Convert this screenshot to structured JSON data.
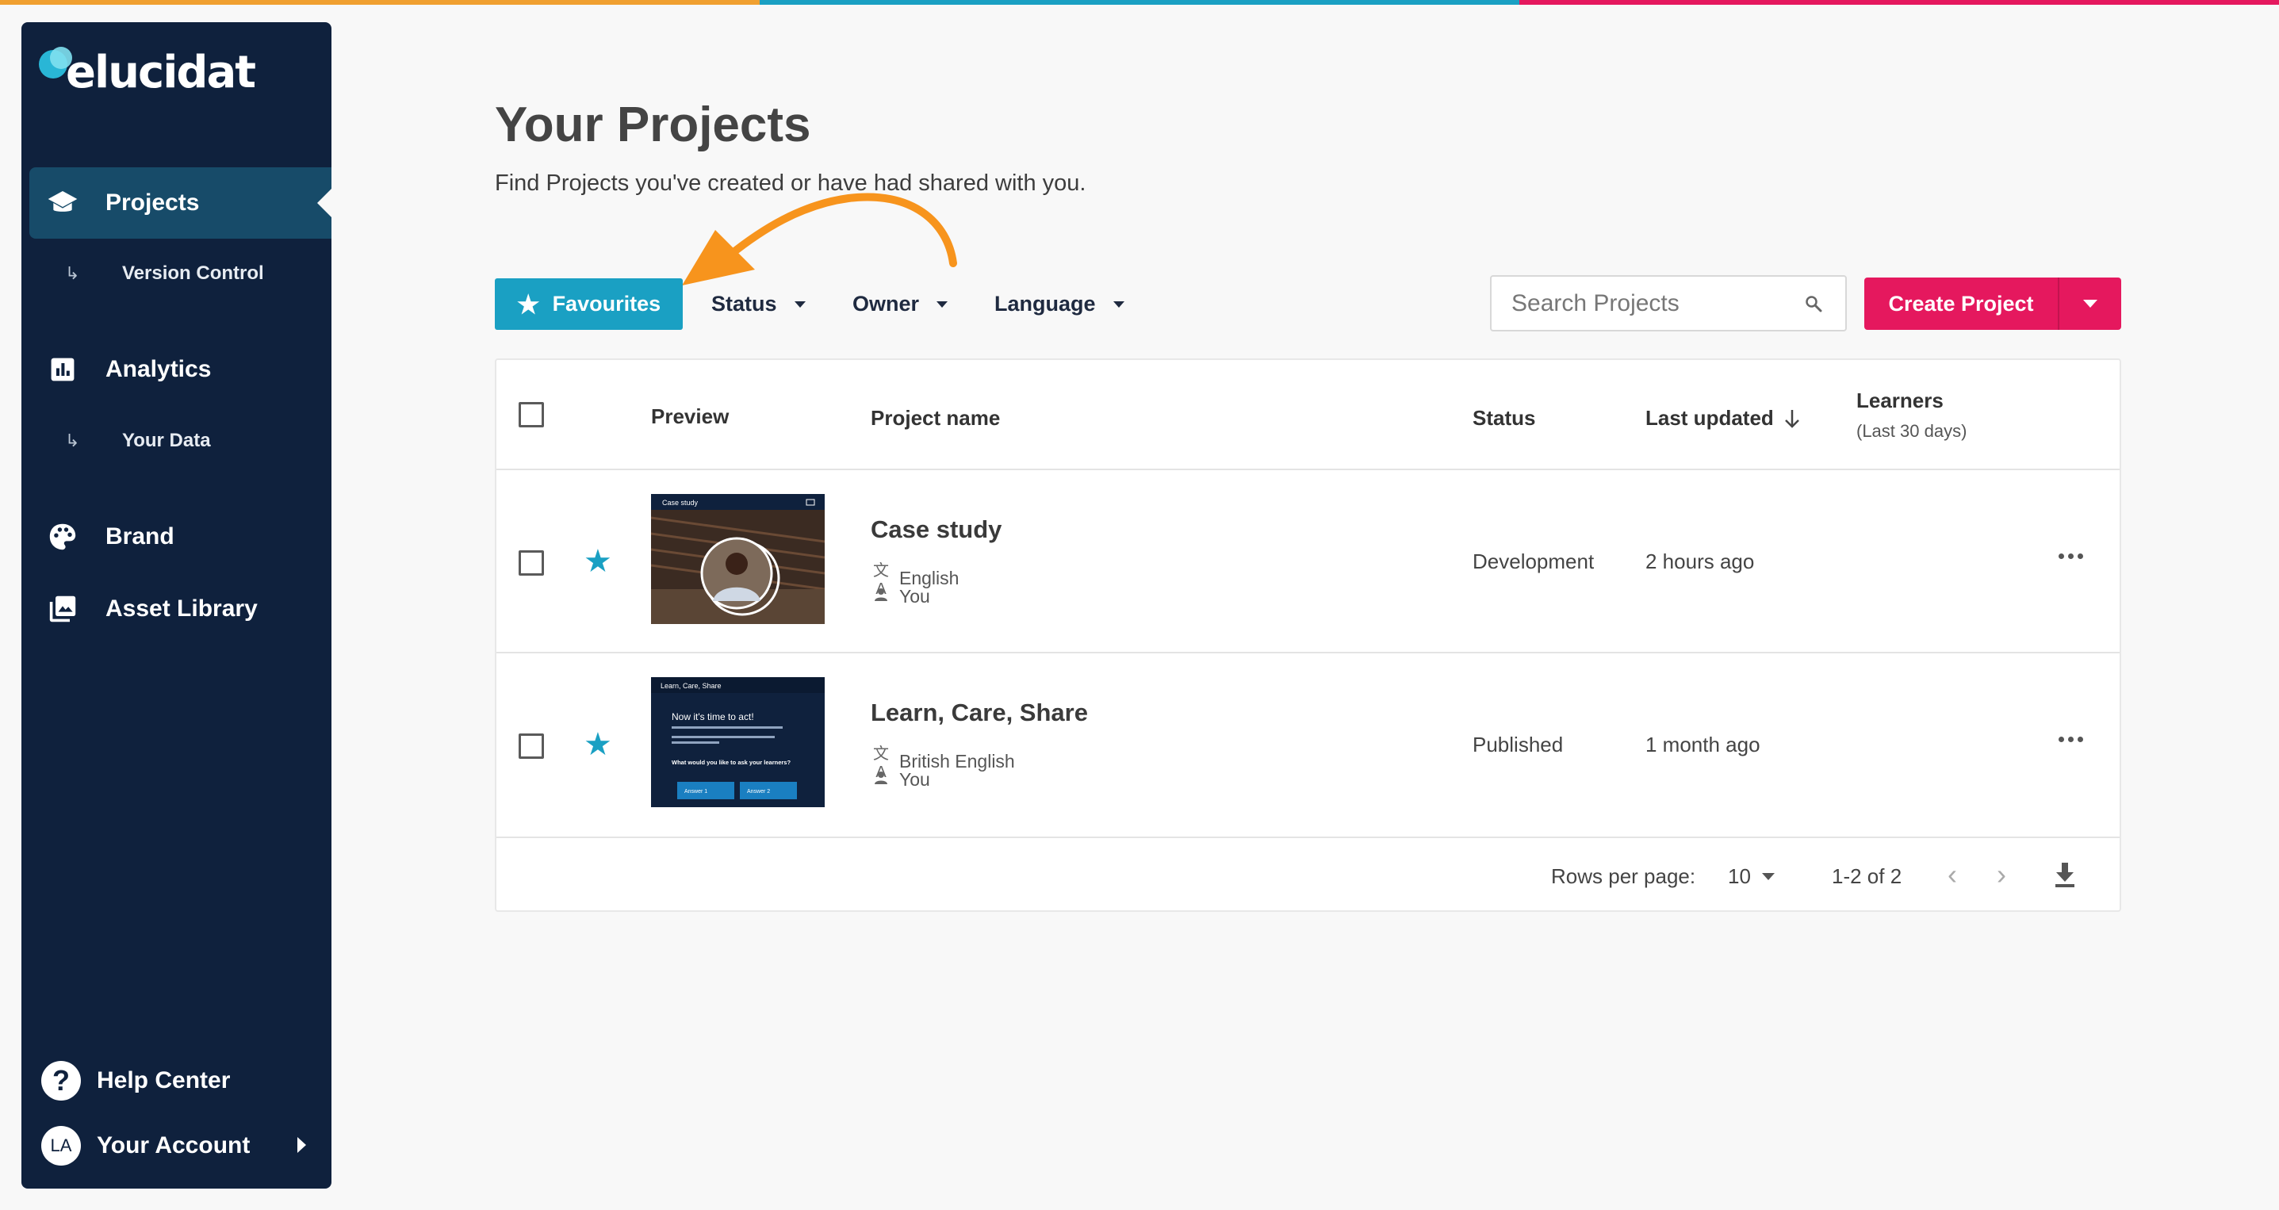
{
  "colors": {
    "top_bar": [
      "#f0a030",
      "#1aa0c3",
      "#e5185e"
    ],
    "sidebar_bg": "#0f213d",
    "sidebar_active": "#174b69",
    "accent_teal": "#1aa0c3",
    "accent_pink": "#e5185e"
  },
  "brand": {
    "logo_text": "elucidat"
  },
  "sidebar": {
    "projects": "Projects",
    "version_control": "Version Control",
    "analytics": "Analytics",
    "your_data": "Your Data",
    "brand": "Brand",
    "asset_library": "Asset Library",
    "help_center": "Help Center",
    "account_initials": "LA",
    "your_account": "Your Account"
  },
  "page": {
    "title": "Your Projects",
    "subtitle": "Find Projects you've created or have had shared with you."
  },
  "filters": {
    "favourites": "Favourites",
    "status": "Status",
    "owner": "Owner",
    "language": "Language"
  },
  "search": {
    "placeholder": "Search Projects"
  },
  "create": {
    "label": "Create Project"
  },
  "table": {
    "columns": {
      "preview": "Preview",
      "project_name": "Project name",
      "status": "Status",
      "last_updated": "Last updated",
      "learners": "Learners",
      "learners_sub": "(Last 30 days)"
    },
    "rows": [
      {
        "name": "Case study",
        "language": "English",
        "owner": "You",
        "status": "Development",
        "updated": "2 hours ago",
        "thumb": {
          "title": "Case study"
        }
      },
      {
        "name": "Learn, Care, Share",
        "language": "British English",
        "owner": "You",
        "status": "Published",
        "updated": "1 month ago",
        "thumb": {
          "title": "Learn, Care, Share",
          "heading": "Now it's time to act!",
          "question": "What would you like to ask your learners?",
          "answer1": "Answer 1",
          "answer2": "Answer 2"
        }
      }
    ],
    "footer": {
      "rows_per_page_label": "Rows per page:",
      "rows_per_page": "10",
      "range": "1-2 of 2"
    }
  }
}
